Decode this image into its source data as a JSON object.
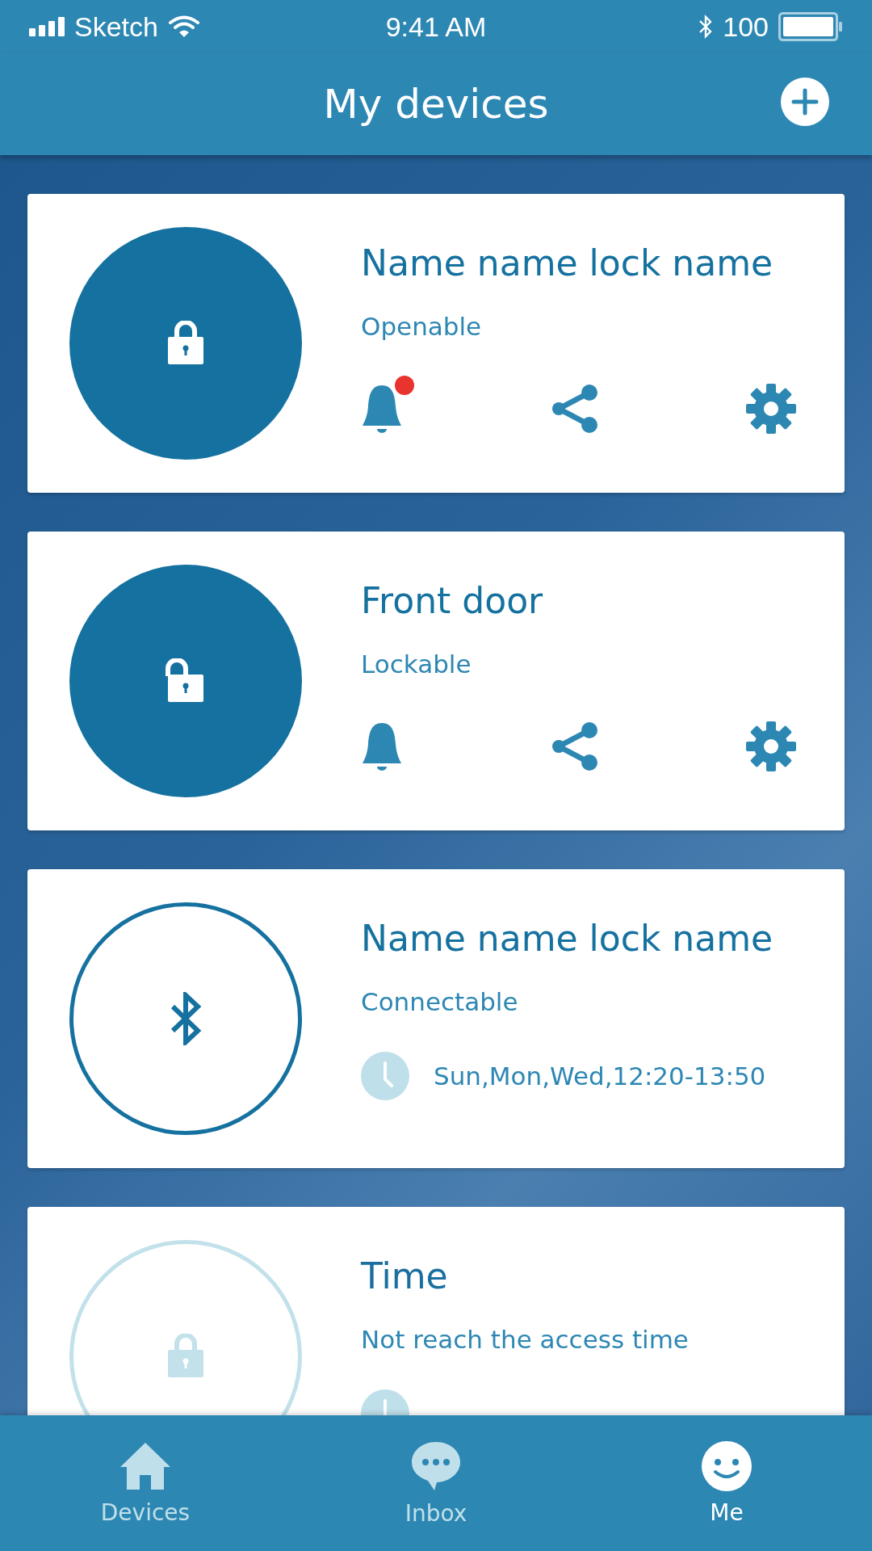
{
  "status_bar": {
    "carrier": "Sketch",
    "time": "9:41 AM",
    "battery": "100"
  },
  "header": {
    "title": "My devices"
  },
  "devices": [
    {
      "kind": "locked",
      "name": "Name name lock name",
      "status": "Openable",
      "details": {
        "kind": "actions",
        "notification": true
      }
    },
    {
      "kind": "unlocked",
      "name": "Front door",
      "status": "Lockable",
      "details": {
        "kind": "actions",
        "notification": false
      }
    },
    {
      "kind": "bluetooth",
      "name": "Name name lock name",
      "status": "Connectable",
      "details": {
        "kind": "schedule",
        "text": "Sun,Mon,Wed,12:20-13:50"
      }
    },
    {
      "kind": "unavailable",
      "name": "Time",
      "status": "Not reach the access time",
      "details": {
        "kind": "schedule"
      }
    }
  ],
  "tabs": [
    {
      "kind": "home",
      "label": "Devices",
      "selected": false
    },
    {
      "kind": "inbox",
      "label": "Inbox",
      "selected": false
    },
    {
      "kind": "me",
      "label": "Me",
      "selected": true
    }
  ]
}
